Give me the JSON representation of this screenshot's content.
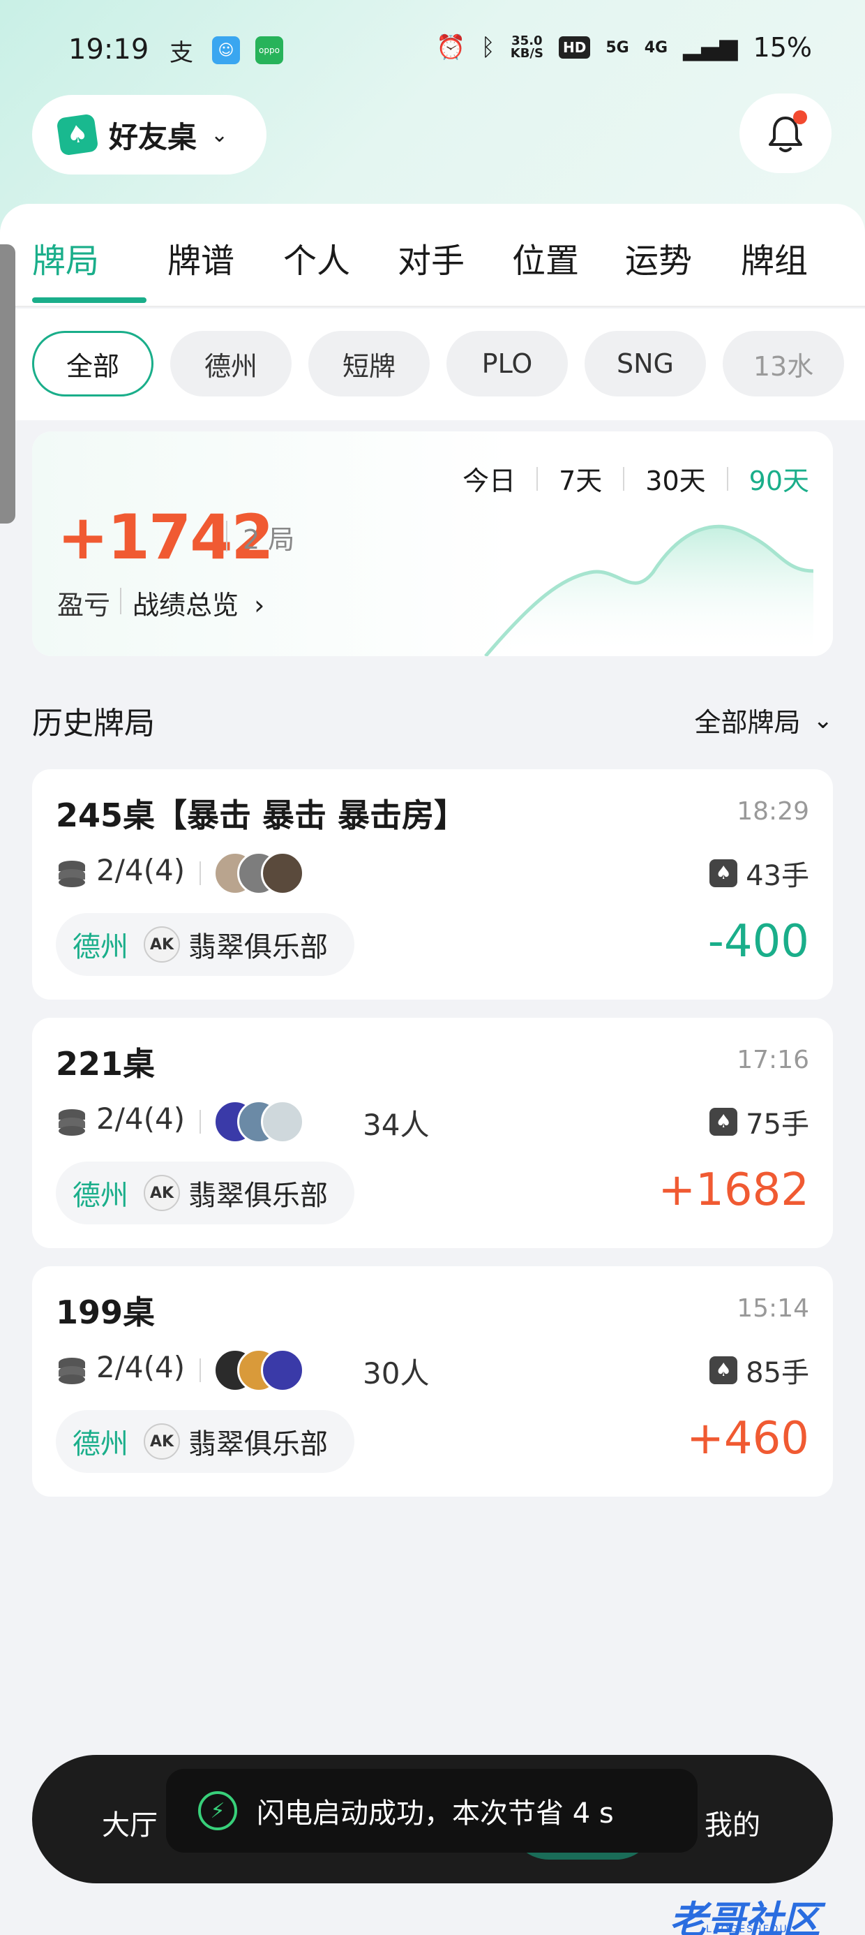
{
  "status_bar": {
    "time": "19:19",
    "net_speed": "35.0",
    "net_unit": "KB/S",
    "hd": "HD",
    "net_5g": "5G",
    "net_4g": "4G",
    "battery": "15%",
    "icons": [
      "alipay-icon",
      "chat-app-icon",
      "oppo-icon",
      "alarm-icon",
      "bluetooth-icon",
      "signal-icon"
    ]
  },
  "header": {
    "room_name": "好友桌",
    "notification_dot_color": "#f24a30"
  },
  "tabs": [
    "牌局",
    "牌谱",
    "个人",
    "对手",
    "位置",
    "运势",
    "牌组"
  ],
  "active_tab": "牌局",
  "chips": [
    "全部",
    "德州",
    "短牌",
    "PLO",
    "SNG",
    "13水"
  ],
  "summary": {
    "periods": [
      "今日",
      "7天",
      "30天",
      "90天"
    ],
    "active_period": "90天",
    "profit": "+1742",
    "games": "2 局",
    "profit_label": "盈亏",
    "overview_link": "战绩总览"
  },
  "history": {
    "title": "历史牌局",
    "filter_label": "全部牌局",
    "games": [
      {
        "title": "245桌【暴击 暴击 暴击房】",
        "time": "18:29",
        "blinds": "2/4(4)",
        "players": "",
        "hands": "43手",
        "type": "德州",
        "club": "翡翠俱乐部",
        "result": "-400"
      },
      {
        "title": "221桌",
        "time": "17:16",
        "blinds": "2/4(4)",
        "players": "34人",
        "hands": "75手",
        "type": "德州",
        "club": "翡翠俱乐部",
        "result": "+1682"
      },
      {
        "title": "199桌",
        "time": "15:14",
        "blinds": "2/4(4)",
        "players": "30人",
        "hands": "85手",
        "type": "德州",
        "club": "翡翠俱乐部",
        "result": "+460"
      }
    ]
  },
  "bottom_nav": {
    "left": "大厅",
    "right": "我的"
  },
  "toast": {
    "text": "闪电启动成功，本次节省 4 s"
  },
  "watermark": {
    "text": "老哥社区",
    "sub": "LAOGESHEQU"
  },
  "colors": {
    "accent": "#1aae8a",
    "positive": "#f05a32",
    "negative": "#1aae8a"
  }
}
